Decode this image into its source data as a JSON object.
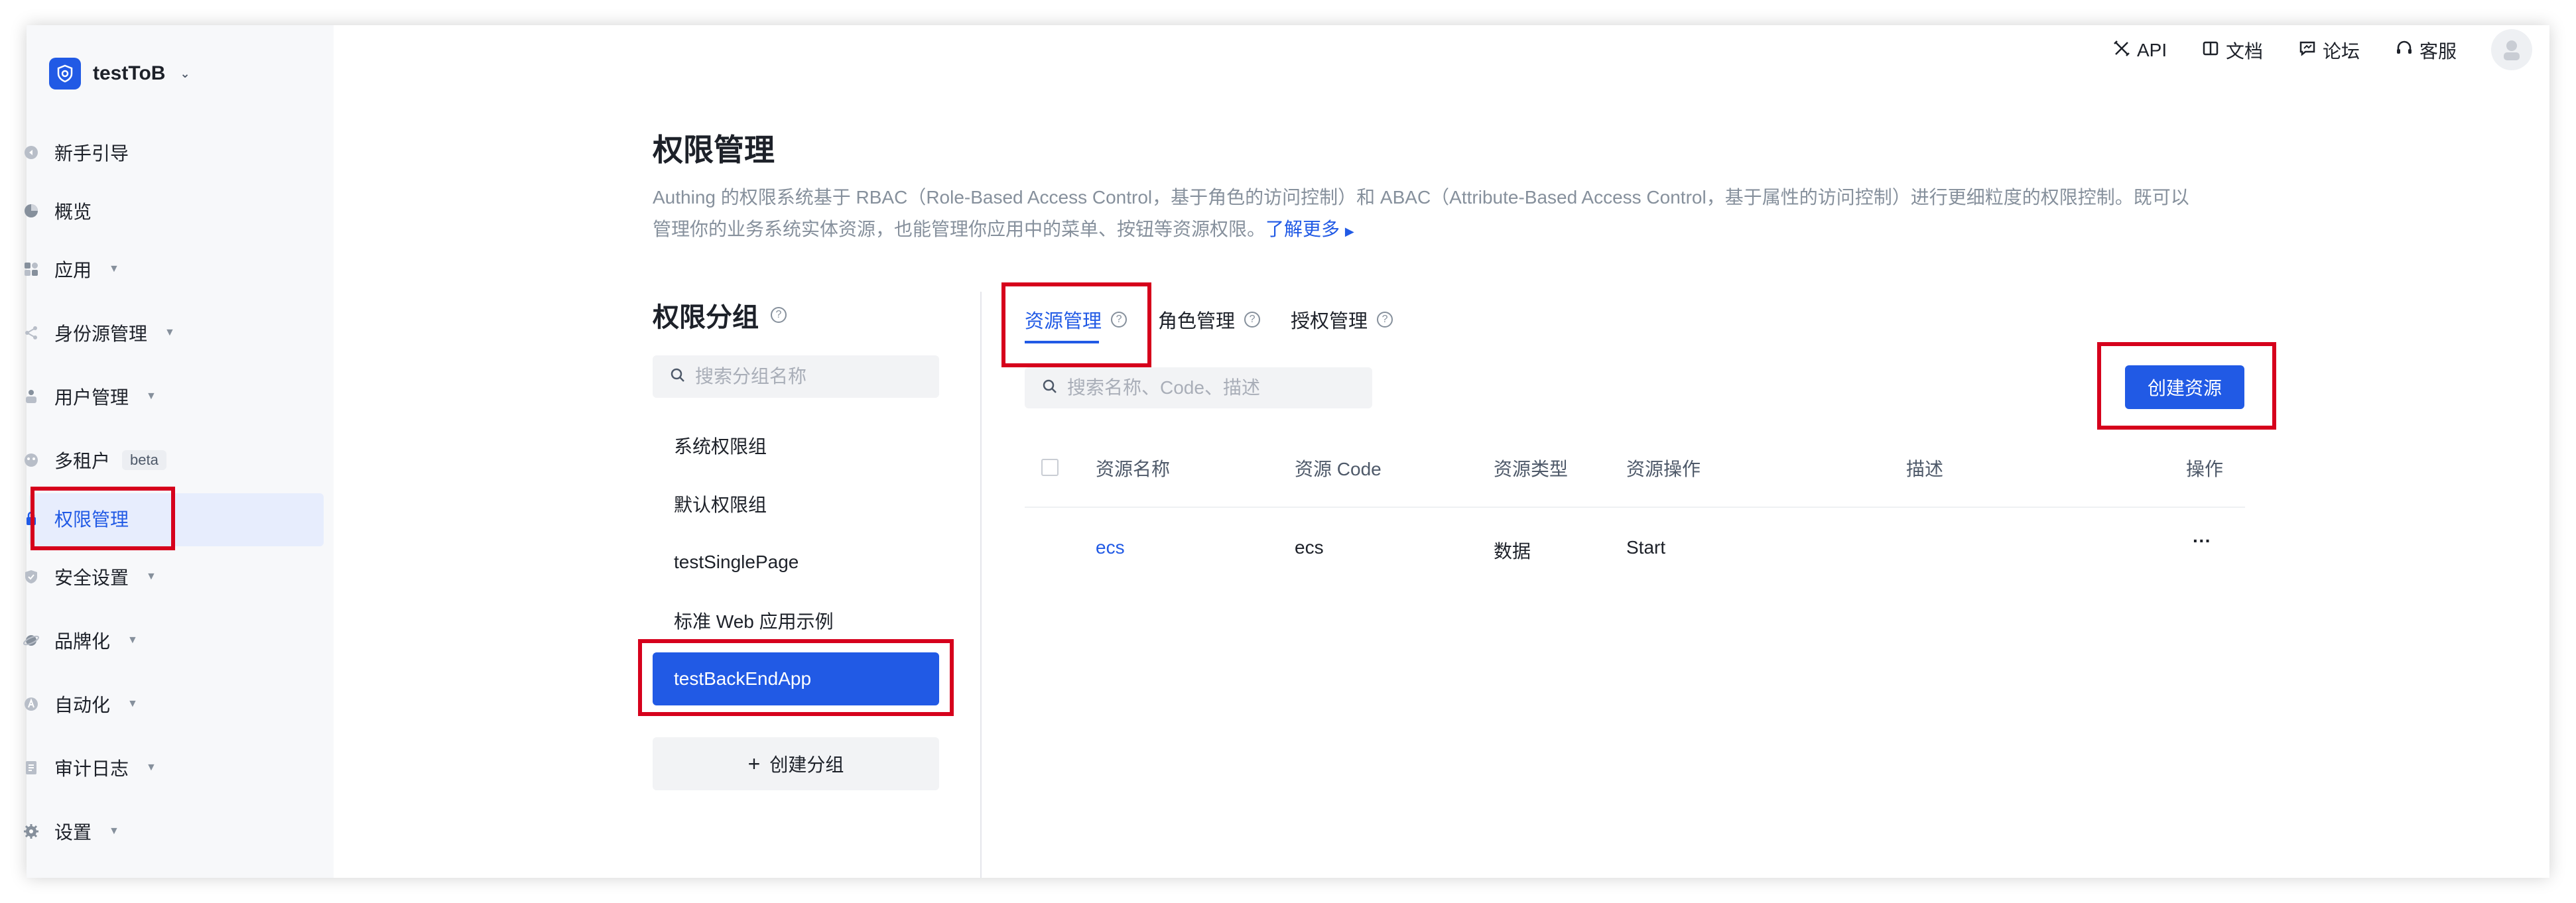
{
  "org": {
    "name": "testToB"
  },
  "sidebar": {
    "items": [
      {
        "label": "新手引导",
        "icon": "guide-icon"
      },
      {
        "label": "概览",
        "icon": "pie-chart-icon"
      },
      {
        "label": "应用",
        "icon": "apps-icon"
      },
      {
        "label": "身份源管理",
        "icon": "share-icon"
      },
      {
        "label": "用户管理",
        "icon": "users-icon"
      },
      {
        "label": "多租户",
        "icon": "tenant-icon",
        "badge": "beta"
      },
      {
        "label": "权限管理",
        "icon": "lock-icon",
        "active": true
      },
      {
        "label": "安全设置",
        "icon": "shield-icon"
      },
      {
        "label": "品牌化",
        "icon": "planet-icon"
      },
      {
        "label": "自动化",
        "icon": "automation-icon"
      },
      {
        "label": "审计日志",
        "icon": "log-icon"
      },
      {
        "label": "设置",
        "icon": "gear-icon"
      }
    ]
  },
  "header": {
    "links": [
      {
        "label": "API",
        "icon": "api-icon"
      },
      {
        "label": "文档",
        "icon": "book-icon"
      },
      {
        "label": "论坛",
        "icon": "chat-icon"
      },
      {
        "label": "客服",
        "icon": "headset-icon"
      }
    ]
  },
  "main": {
    "title": "权限管理",
    "desc_line1": "Authing 的权限系统基于 RBAC（Role-Based Access Control，基于角色的访问控制）和 ABAC（Attribute-Based Access Control，基于属性的访问控制）进行更细粒度的权限控制。既可以",
    "desc_line2": "管理你的业务系统实体资源，也能管理你应用中的菜单、按钮等资源权限。",
    "more_link": "了解更多",
    "groups": {
      "title": "权限分组",
      "search_placeholder": "搜索分组名称",
      "items": [
        "系统权限组",
        "默认权限组",
        "testSinglePage",
        "标准 Web 应用示例",
        "testBackEndApp"
      ],
      "active_index": 4,
      "create_label": "创建分组"
    },
    "tabs": [
      {
        "label": "资源管理",
        "active": true
      },
      {
        "label": "角色管理"
      },
      {
        "label": "授权管理"
      }
    ],
    "resource_search_placeholder": "搜索名称、Code、描述",
    "create_resource_label": "创建资源",
    "table": {
      "columns": [
        "资源名称",
        "资源 Code",
        "资源类型",
        "资源操作",
        "描述",
        "操作"
      ],
      "rows": [
        {
          "name": "ecs",
          "code": "ecs",
          "type": "数据",
          "actions": "Start",
          "desc": "",
          "more": "···"
        }
      ]
    }
  },
  "colors": {
    "accent": "#215ae5",
    "highlight_box": "#d6001c",
    "sidebar_bg": "#f7f8fa"
  }
}
